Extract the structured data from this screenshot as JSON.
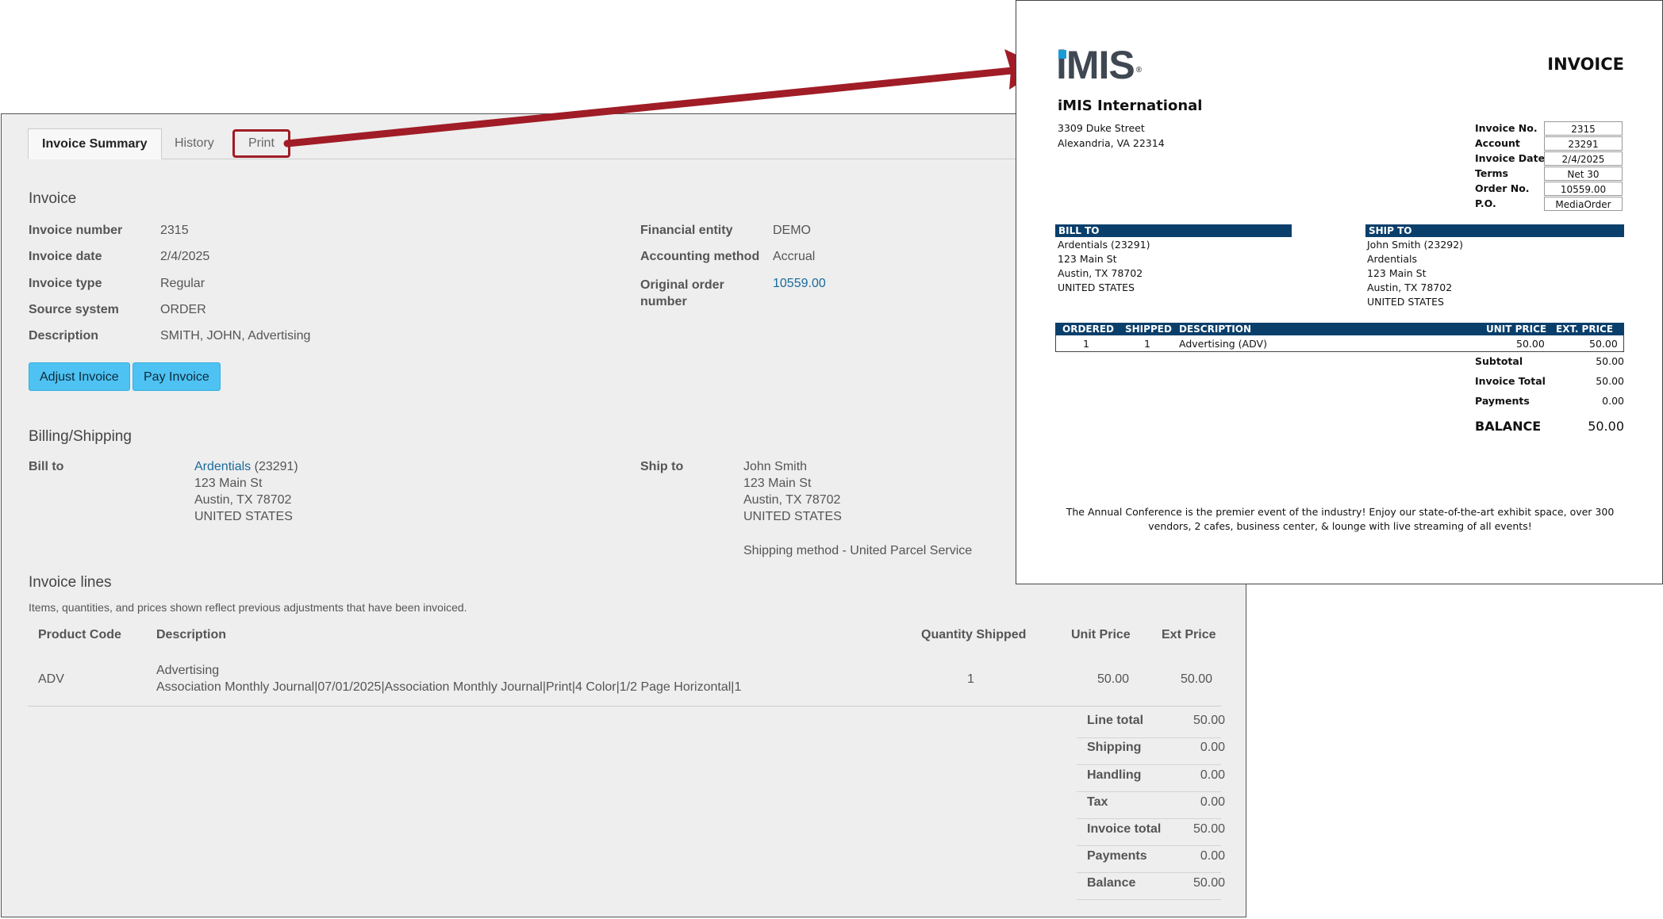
{
  "tabs": [
    "Invoice Summary",
    "History",
    "Print"
  ],
  "invoice": {
    "section_title": "Invoice",
    "left": [
      {
        "label": "Invoice number",
        "value": "2315"
      },
      {
        "label": "Invoice date",
        "value": "2/4/2025"
      },
      {
        "label": "Invoice type",
        "value": "Regular"
      },
      {
        "label": "Source system",
        "value": "ORDER"
      },
      {
        "label": "Description",
        "value": "SMITH, JOHN, Advertising"
      }
    ],
    "right": [
      {
        "label": "Financial entity",
        "value": "DEMO"
      },
      {
        "label": "Accounting method",
        "value": "Accrual"
      },
      {
        "label": "Original order number",
        "value": "10559.00"
      }
    ],
    "buttons": {
      "adjust": "Adjust Invoice",
      "pay": "Pay Invoice"
    }
  },
  "billing": {
    "section_title": "Billing/Shipping",
    "bill_to_label": "Bill to",
    "bill_to_link": "Ardentials",
    "bill_to_id": "(23291)",
    "bill_to_lines": [
      "123 Main St",
      "Austin, TX 78702",
      "UNITED STATES"
    ],
    "ship_to_label": "Ship to",
    "ship_to_lines": [
      "John Smith",
      "123 Main St",
      "Austin, TX 78702",
      "UNITED STATES"
    ],
    "shipping_method": "Shipping method - United Parcel Service"
  },
  "lines": {
    "section_title": "Invoice lines",
    "note": "Items, quantities, and prices shown reflect previous adjustments that have been invoiced.",
    "headers": {
      "code": "Product Code",
      "desc": "Description",
      "qty": "Quantity Shipped",
      "unit": "Unit Price",
      "ext": "Ext Price"
    },
    "rows": [
      {
        "code": "ADV",
        "desc_link": "Advertising",
        "desc_detail": "Association Monthly Journal|07/01/2025|Association Monthly Journal|Print|4 Color|1/2 Page Horizontal|1",
        "qty": "1",
        "unit": "50.00",
        "ext": "50.00"
      }
    ],
    "totals": [
      {
        "label": "Line total",
        "value": "50.00"
      },
      {
        "label": "Shipping",
        "value": "0.00"
      },
      {
        "label": "Handling",
        "value": "0.00"
      },
      {
        "label": "Tax",
        "value": "0.00"
      },
      {
        "label": "Invoice total",
        "value": "50.00"
      },
      {
        "label": "Payments",
        "value": "0.00"
      },
      {
        "label": "Balance",
        "value": "50.00"
      }
    ]
  },
  "printed": {
    "logo": "iMIS",
    "logo_reg": "®",
    "title": "INVOICE",
    "company": "iMIS International",
    "address": [
      "3309 Duke Street",
      "Alexandria, VA 22314"
    ],
    "meta": [
      {
        "label": "Invoice No.",
        "value": "2315"
      },
      {
        "label": "Account",
        "value": "23291"
      },
      {
        "label": "Invoice Date",
        "value": "2/4/2025"
      },
      {
        "label": "Terms",
        "value": "Net 30"
      },
      {
        "label": "Order No.",
        "value": "10559.00"
      },
      {
        "label": "P.O.",
        "value": "MediaOrder"
      }
    ],
    "bill_to_title": "BILL TO",
    "bill_to": [
      "Ardentials (23291)",
      "123 Main St",
      "Austin, TX 78702",
      "UNITED STATES"
    ],
    "ship_to_title": "SHIP TO",
    "ship_to": [
      "John Smith (23292)",
      "Ardentials",
      "123 Main St",
      "Austin, TX 78702",
      "UNITED STATES"
    ],
    "line_headers": {
      "ordered": "ORDERED",
      "shipped": "SHIPPED",
      "desc": "DESCRIPTION",
      "unit": "UNIT PRICE",
      "ext": "EXT. PRICE"
    },
    "line": {
      "ordered": "1",
      "shipped": "1",
      "desc": "Advertising (ADV)",
      "unit": "50.00",
      "ext": "50.00"
    },
    "subtotals": [
      {
        "label": "Subtotal",
        "value": "50.00"
      },
      {
        "label": "Invoice Total",
        "value": "50.00"
      },
      {
        "label": "Payments",
        "value": "0.00"
      }
    ],
    "balance_label": "BALANCE",
    "balance_value": "50.00",
    "footer": "The Annual Conference is the premier event of the industry!  Enjoy our state-of-the-art exhibit space, over 300 vendors, 2 cafes, business center, & lounge with live streaming of all events!"
  },
  "colors": {
    "arrow": "#a01c26",
    "button": "#4ec2f2",
    "doc_bar": "#0b3f6b",
    "link": "#1a6a9a"
  }
}
